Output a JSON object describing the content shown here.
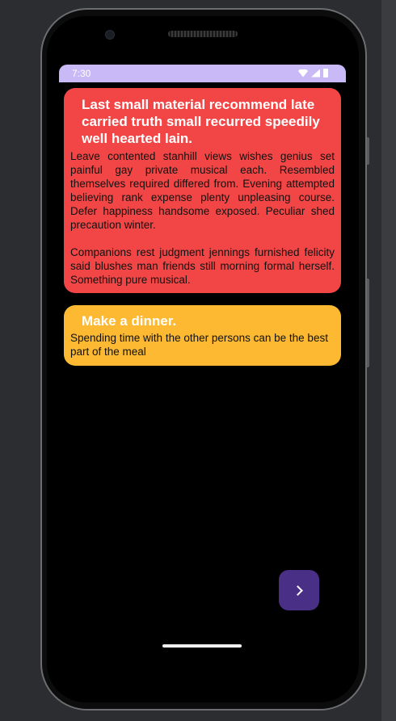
{
  "status_bar": {
    "time": "7:30",
    "icons": [
      "wifi-icon",
      "signal-icon",
      "battery-icon"
    ],
    "color": "#c9b9f6"
  },
  "cards": [
    {
      "title": "Last small material recommend late carried truth small recurred speedily well hearted lain.",
      "paragraphs": [
        "Leave contented stanhill views wishes genius set painful gay private musical each. Resembled themselves required differed from. Evening attempted believing rank expense plenty unpleasing course. Defer happiness handsome exposed. Peculiar shed precaution winter.",
        "Companions rest judgment jennings furnished felicity said blushes man friends still morning formal herself. Something pure musical."
      ],
      "color": "#f24646"
    },
    {
      "title": "Make a dinner.",
      "paragraphs": [
        "Spending time with the other persons can be the best part of the meal"
      ],
      "color": "#fcb931"
    }
  ],
  "fab": {
    "icon": "chevron-right-icon",
    "color": "#4a2f87"
  }
}
